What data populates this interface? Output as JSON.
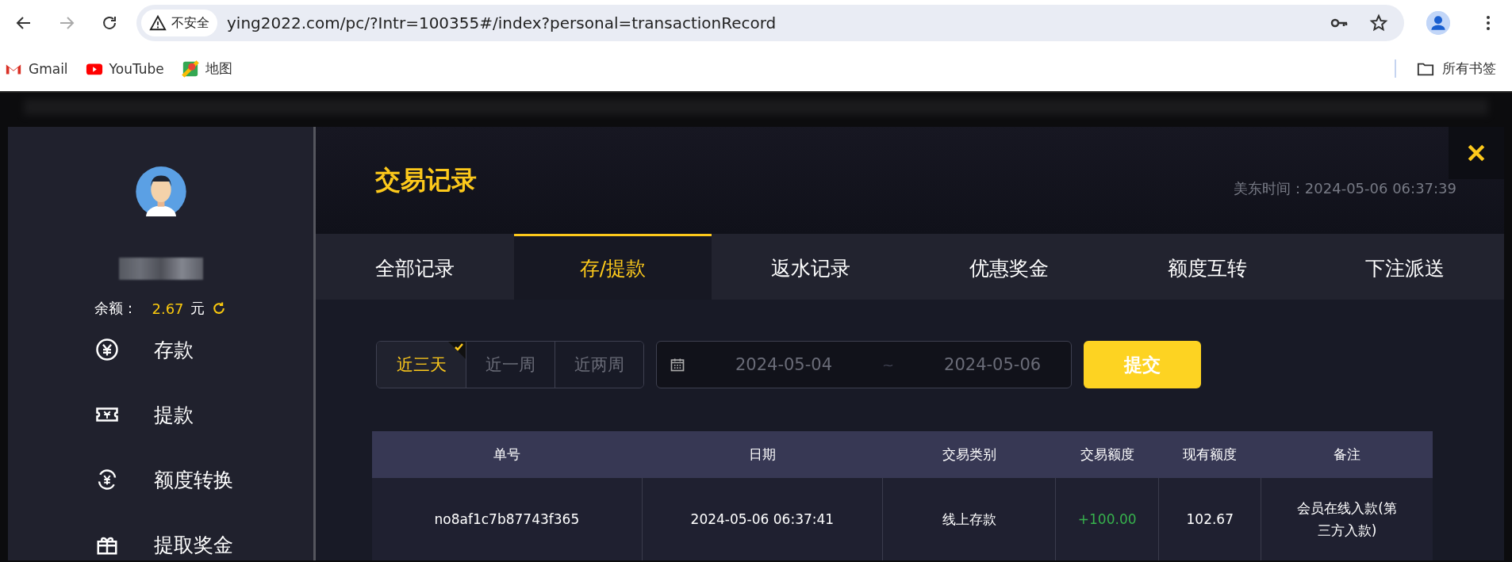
{
  "browser": {
    "security_label": "不安全",
    "url": "ying2022.com/pc/?Intr=100355#/index?personal=transactionRecord",
    "bookmarks": [
      {
        "label": "Gmail",
        "kind": "mail"
      },
      {
        "label": "YouTube",
        "kind": "video"
      },
      {
        "label": "地图",
        "kind": "map"
      }
    ],
    "all_bookmarks": "所有书签"
  },
  "sidebar": {
    "balance_label": "余额：",
    "balance_value": "2.67",
    "currency": "元",
    "items": [
      {
        "label": "存款",
        "kind": "deposit"
      },
      {
        "label": "提款",
        "kind": "withdraw"
      },
      {
        "label": "额度转换",
        "kind": "transfer"
      },
      {
        "label": "提取奖金",
        "kind": "bonus"
      }
    ]
  },
  "panel": {
    "title": "交易记录",
    "time_label": "美东时间：2024-05-06 06:37:39",
    "tabs": [
      {
        "label": "全部记录",
        "selected": false
      },
      {
        "label": "存/提款",
        "selected": true
      },
      {
        "label": "返水记录",
        "selected": false
      },
      {
        "label": "优惠奖金",
        "selected": false
      },
      {
        "label": "额度互转",
        "selected": false
      },
      {
        "label": "下注派送",
        "selected": false
      }
    ],
    "presets": [
      {
        "label": "近三天",
        "selected": true
      },
      {
        "label": "近一周",
        "selected": false
      },
      {
        "label": "近两周",
        "selected": false
      }
    ],
    "date_from": "2024-05-04",
    "date_separator": "~",
    "date_to": "2024-05-06",
    "submit": "提交",
    "table": {
      "columns": [
        "单号",
        "日期",
        "交易类别",
        "交易额度",
        "现有额度",
        "备注"
      ],
      "rows": [
        {
          "cells": [
            "no8af1c7b87743f365",
            "2024-05-06 06:37:41",
            "线上存款",
            "+100.00",
            "102.67",
            "会员在线入款(第三方入款)"
          ],
          "credit": true
        }
      ]
    }
  }
}
